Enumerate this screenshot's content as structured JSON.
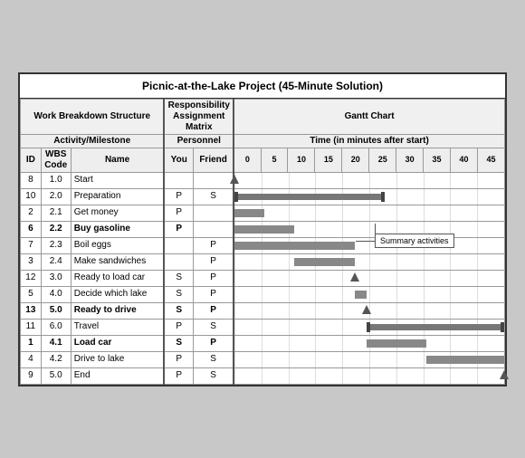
{
  "title": "Picnic-at-the-Lake Project (45-Minute Solution)",
  "sections": {
    "wbs_header": "Work Breakdown Structure",
    "ram_header": "Responsibility Assignment Matrix",
    "gantt_header": "Gantt Chart",
    "activity_header": "Activity/Milestone",
    "personnel_header": "Personnel",
    "time_header": "Time (in minutes after start)",
    "col_id": "ID",
    "col_wbs": "WBS Code",
    "col_name": "Name",
    "col_you": "You",
    "col_friend": "Friend"
  },
  "time_marks": [
    "0",
    "5",
    "10",
    "15",
    "20",
    "25",
    "30",
    "35",
    "40",
    "45"
  ],
  "activities": [
    {
      "id": "8",
      "wbs": "1.0",
      "name": "Start",
      "you": "",
      "friend": "",
      "bold": false,
      "milestone": true,
      "milestone_time": 0,
      "bar": false,
      "bar_start": 0,
      "bar_end": 0
    },
    {
      "id": "10",
      "wbs": "2.0",
      "name": "Preparation",
      "you": "P",
      "friend": "S",
      "bold": false,
      "milestone": false,
      "bar": true,
      "bar_start": 0,
      "bar_end": 25,
      "summary": true
    },
    {
      "id": "2",
      "wbs": "2.1",
      "name": "Get money",
      "you": "P",
      "friend": "",
      "bold": false,
      "milestone": false,
      "bar": true,
      "bar_start": 0,
      "bar_end": 5
    },
    {
      "id": "6",
      "wbs": "2.2",
      "name": "Buy gasoline",
      "you": "P",
      "friend": "",
      "bold": true,
      "milestone": false,
      "bar": true,
      "bar_start": 0,
      "bar_end": 10
    },
    {
      "id": "7",
      "wbs": "2.3",
      "name": "Boil eggs",
      "you": "",
      "friend": "P",
      "bold": false,
      "milestone": false,
      "bar": true,
      "bar_start": 0,
      "bar_end": 20,
      "summary_label": true
    },
    {
      "id": "3",
      "wbs": "2.4",
      "name": "Make sandwiches",
      "you": "",
      "friend": "P",
      "bold": false,
      "milestone": false,
      "bar": true,
      "bar_start": 10,
      "bar_end": 20
    },
    {
      "id": "12",
      "wbs": "3.0",
      "name": "Ready to load car",
      "you": "S",
      "friend": "P",
      "bold": false,
      "milestone": true,
      "milestone_time": 20,
      "bar": false
    },
    {
      "id": "5",
      "wbs": "4.0",
      "name": "Decide which lake",
      "you": "S",
      "friend": "P",
      "bold": false,
      "milestone": false,
      "bar": true,
      "bar_start": 20,
      "bar_end": 22
    },
    {
      "id": "13",
      "wbs": "5.0",
      "name": "Ready to drive",
      "you": "S",
      "friend": "P",
      "bold": true,
      "milestone": true,
      "milestone_time": 22,
      "bar": false
    },
    {
      "id": "11",
      "wbs": "6.0",
      "name": "Travel",
      "you": "P",
      "friend": "S",
      "bold": false,
      "milestone": false,
      "bar": true,
      "bar_start": 22,
      "bar_end": 45,
      "summary2": true
    },
    {
      "id": "1",
      "wbs": "4.1",
      "name": "Load car",
      "you": "S",
      "friend": "P",
      "bold": true,
      "milestone": false,
      "bar": true,
      "bar_start": 22,
      "bar_end": 32
    },
    {
      "id": "4",
      "wbs": "4.2",
      "name": "Drive to lake",
      "you": "P",
      "friend": "S",
      "bold": false,
      "milestone": false,
      "bar": true,
      "bar_start": 32,
      "bar_end": 45
    },
    {
      "id": "9",
      "wbs": "5.0",
      "name": "End",
      "you": "P",
      "friend": "S",
      "bold": false,
      "milestone": true,
      "milestone_time": 45,
      "bar": false
    }
  ],
  "summary_label": "Summary activities"
}
